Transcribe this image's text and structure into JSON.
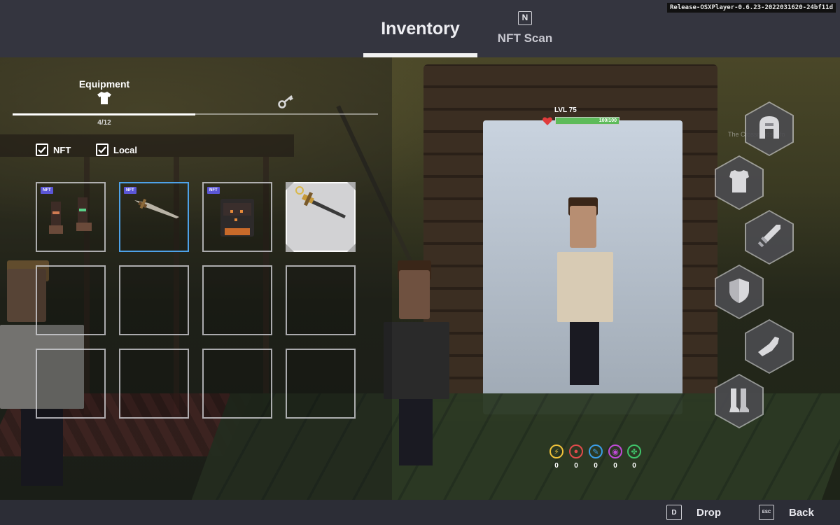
{
  "build_label": "Release-OSXPlayer-0.6.23-2022031620-24bf11d",
  "top_tabs": {
    "inventory": "Inventory",
    "nft_scan": "NFT Scan",
    "nft_scan_key": "N"
  },
  "inventory": {
    "sub_tabs": {
      "equipment": "Equipment"
    },
    "count": "4/12",
    "filters": [
      {
        "label": "NFT",
        "checked": true
      },
      {
        "label": "Local",
        "checked": true
      }
    ],
    "slots": [
      {
        "item": "boots",
        "nft_badge": "NFT",
        "state": "normal"
      },
      {
        "item": "sword",
        "nft_badge": "NFT",
        "state": "selected"
      },
      {
        "item": "helmet",
        "nft_badge": "NFT",
        "state": "normal"
      },
      {
        "item": "sword",
        "nft_badge": "",
        "state": "highlight"
      },
      {
        "item": "",
        "nft_badge": "",
        "state": "empty"
      },
      {
        "item": "",
        "nft_badge": "",
        "state": "empty"
      },
      {
        "item": "",
        "nft_badge": "",
        "state": "empty"
      },
      {
        "item": "",
        "nft_badge": "",
        "state": "empty"
      },
      {
        "item": "",
        "nft_badge": "",
        "state": "empty"
      },
      {
        "item": "",
        "nft_badge": "",
        "state": "empty"
      },
      {
        "item": "",
        "nft_badge": "",
        "state": "empty"
      },
      {
        "item": "",
        "nft_badge": "",
        "state": "empty"
      }
    ]
  },
  "hud": {
    "level": "LVL 75",
    "health": "100/100",
    "health_fraction": 1.0,
    "health_color": "#5dbb5a"
  },
  "equipment_slots": [
    "helmet-icon",
    "chestplate-icon",
    "sword-icon",
    "shield-icon",
    "gauntlet-icon",
    "boots-icon"
  ],
  "elements": [
    {
      "icon": "lightning-icon",
      "color": "#f0c23a",
      "value": "0"
    },
    {
      "icon": "fire-shield-icon",
      "color": "#e24b4b",
      "value": "0"
    },
    {
      "icon": "water-icon",
      "color": "#3a9ee8",
      "value": "0"
    },
    {
      "icon": "arcane-icon",
      "color": "#c04ad8",
      "value": "0"
    },
    {
      "icon": "nature-icon",
      "color": "#3fc46a",
      "value": "0"
    }
  ],
  "bottom_actions": {
    "drop_key": "D",
    "drop": "Drop",
    "back_key": "ESC",
    "back": "Back"
  },
  "colors": {
    "top_bar": "#34353f",
    "bottom_bar": "#2c2d36",
    "selected_border": "#4ea2e8",
    "nft_badge": "#5b56d6"
  }
}
